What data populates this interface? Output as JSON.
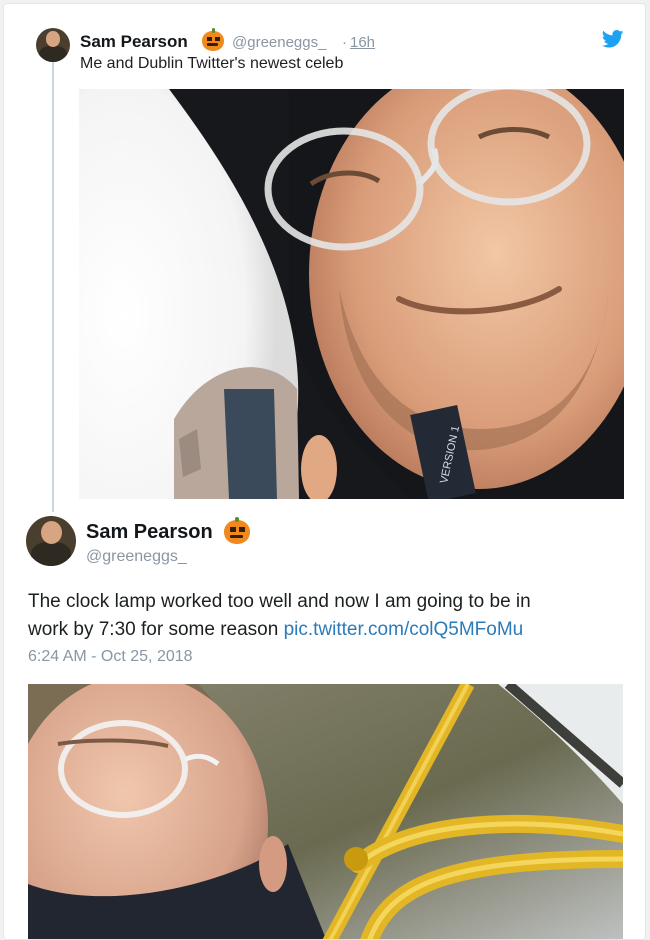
{
  "tweet1": {
    "name": "Sam Pearson",
    "handle": "@greeneggs_",
    "separator": "·",
    "time": "16h",
    "text": "Me and Dublin Twitter's newest celeb"
  },
  "tweet2": {
    "name": "Sam Pearson",
    "handle": "@greeneggs_",
    "text_line1": "The clock lamp worked too well and now I am going to be in",
    "text_line2_plain": "work by 7:30 for some reason ",
    "text_link": "pic.twitter.com/colQ5MFoMu",
    "timestamp": "6:24 AM - Oct 25, 2018"
  },
  "photo1_lanyard_text": "VERSION 1",
  "icons": {
    "brand": "twitter-bird-icon",
    "emoji": "jack-o-lantern-icon"
  },
  "colors": {
    "brand_blue": "#1da1f2",
    "link_blue": "#2b7bb9",
    "muted_gray": "#8a96a3",
    "thread_line": "#c9d6df"
  }
}
